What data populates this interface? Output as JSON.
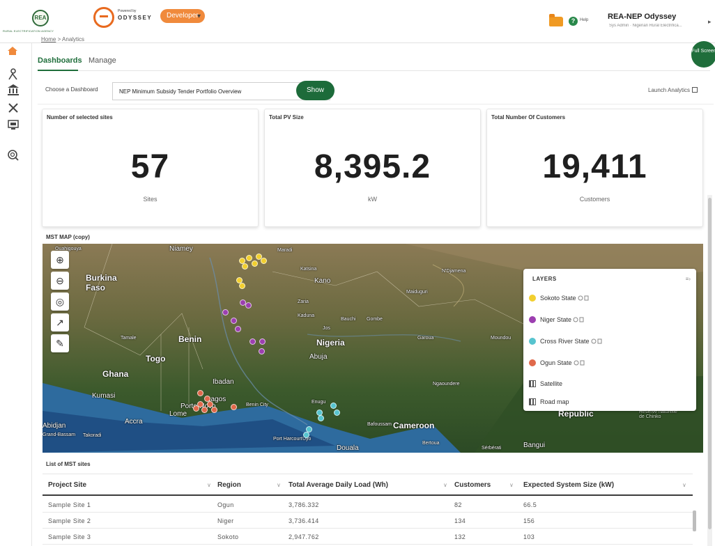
{
  "header": {
    "agency_name": "RURAL ELECTRIFICATION AGENCY",
    "rea_initials": "REA",
    "powered_by": "Powered by",
    "odyssey_brand": "ODYSSEY",
    "env_pill": "Developer",
    "help_label": "Help",
    "user_name": "REA-NEP Odyssey",
    "user_role": "Sys Admin · Nigerian Rural Electrifica..."
  },
  "breadcrumb": {
    "home": "Home",
    "separator": ">",
    "current": "Analytics"
  },
  "tabs": [
    {
      "label": "Dashboards"
    },
    {
      "label": "Manage"
    }
  ],
  "fullscreen_label": "Full Screen",
  "controls": {
    "choose_label": "Choose a Dashboard",
    "selected_dashboard": "NEP Minimum Subsidy Tender Portfolio Overview",
    "show_label": "Show",
    "launch_label": "Launch Analytics"
  },
  "cards": [
    {
      "title": "Number of selected sites",
      "value": "57",
      "unit": "Sites"
    },
    {
      "title": "Total PV Size",
      "value": "8,395.2",
      "unit": "kW"
    },
    {
      "title": "Total Number Of Customers",
      "value": "19,411",
      "unit": "Customers"
    }
  ],
  "map": {
    "title": "MST MAP (copy)",
    "place_labels": [
      "Ouahigouya",
      "Niamey",
      "Maradi",
      "Burkina Faso",
      "Katsina",
      "Kano",
      "N'Djamena",
      "Maiduguri",
      "Zaria",
      "Kaduna",
      "Bauchi",
      "Gombe",
      "Tamale",
      "Benin",
      "Nigeria",
      "Jos",
      "Garoua",
      "Togo",
      "Abuja",
      "Moundou",
      "Ghana",
      "Ibadan",
      "Ngaoundere",
      "Kumasi",
      "Porto-Novo",
      "Lagos",
      "Benin City",
      "Enugu",
      "Lome",
      "Accra",
      "Cameroon",
      "Abidjan",
      "Grand-Bassam",
      "Takoradi",
      "Bafoussam",
      "Port Harcourt",
      "Uyo",
      "Douala",
      "Bertoua",
      "Bangui",
      "Republic",
      "Réserve naturelle de Chinko",
      "Sérbérati"
    ],
    "layers_title": "LAYERS",
    "layers": [
      {
        "label": "Sokoto State",
        "color": "#f2cf2f",
        "kind": "dot"
      },
      {
        "label": "Niger State",
        "color": "#9c3fb0",
        "kind": "dot"
      },
      {
        "label": "Cross River State",
        "color": "#57c4cf",
        "kind": "dot"
      },
      {
        "label": "Ogun State",
        "color": "#e0694b",
        "kind": "dot"
      },
      {
        "label": "Satellite",
        "color": "#555555",
        "kind": "grid"
      },
      {
        "label": "Road map",
        "color": "#555555",
        "kind": "grid"
      }
    ]
  },
  "table": {
    "title": "List of MST sites",
    "columns": [
      "Project Site",
      "Region",
      "Total Average Daily Load (Wh)",
      "Customers",
      "Expected System Size (kW)"
    ],
    "rows": [
      [
        "Sample Site 1",
        "Ogun",
        "3,786.332",
        "82",
        "66.5"
      ],
      [
        "Sample Site 2",
        "Niger",
        "3,736.414",
        "134",
        "156"
      ],
      [
        "Sample Site 3",
        "Sokoto",
        "2,947.762",
        "132",
        "103"
      ]
    ]
  },
  "colors": {
    "brand_green": "#1d6b3a",
    "accent_orange": "#f08a3c"
  }
}
